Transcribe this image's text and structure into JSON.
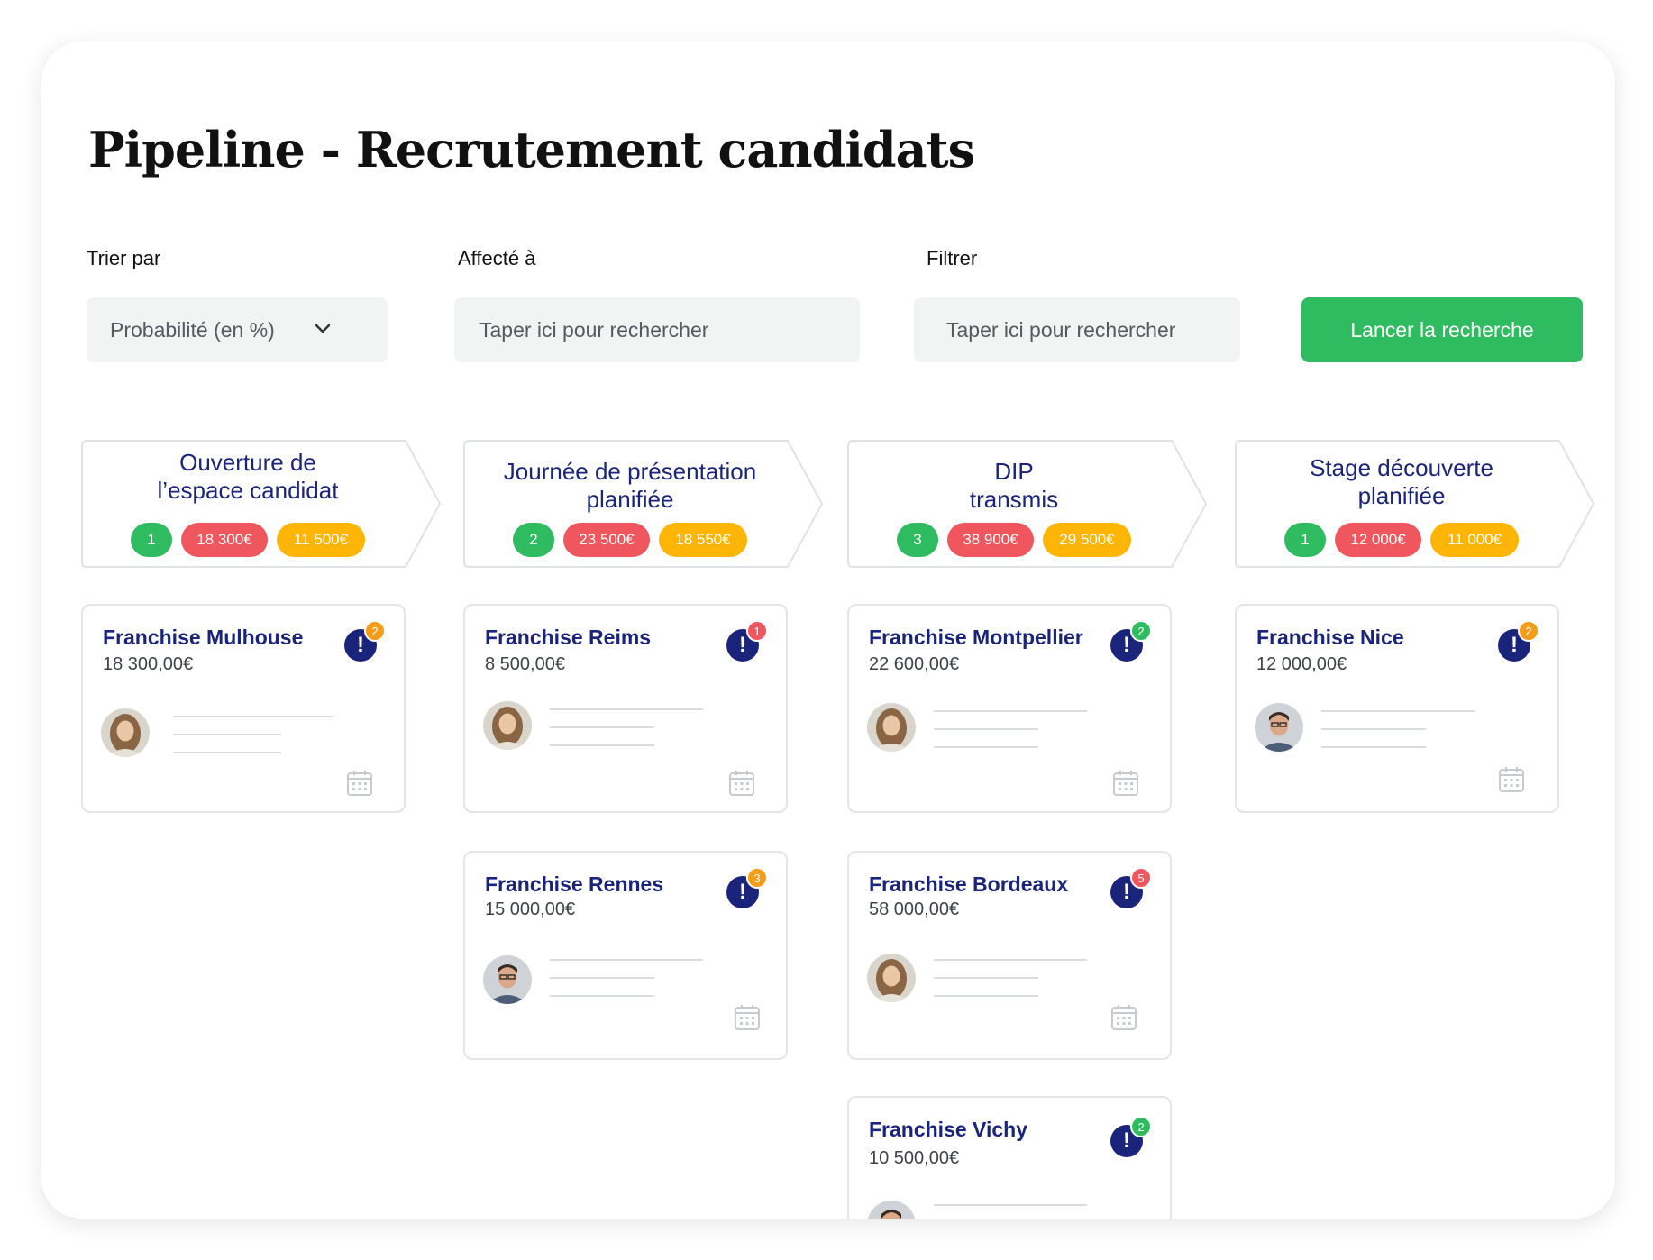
{
  "page": {
    "title": "Pipeline - Recrutement candidats"
  },
  "filters": {
    "sort_label": "Trier par",
    "sort_value": "Probabilité (en %)",
    "assigned_label": "Affecté à",
    "assigned_placeholder": "Taper ici pour rechercher",
    "filter_label": "Filtrer",
    "filter_placeholder": "Taper ici pour rechercher",
    "search_button": "Lancer la recherche"
  },
  "colors": {
    "brand_green": "#2fbb5f",
    "navy": "#1a247a",
    "red": "#f0565e",
    "yellow": "#ffb505",
    "orange": "#f59c1a"
  },
  "stages": [
    {
      "title": "Ouverture de\nl’espace candidat",
      "count": "1",
      "amount_red": "18 300€",
      "amount_yellow": "11 500€"
    },
    {
      "title": "Journée de présentation\nplanifiée",
      "count": "2",
      "amount_red": "23 500€",
      "amount_yellow": "18 550€"
    },
    {
      "title": "DIP\ntransmis",
      "count": "3",
      "amount_red": "38 900€",
      "amount_yellow": "29 500€"
    },
    {
      "title": "Stage découverte\nplanifiée",
      "count": "1",
      "amount_red": "12 000€",
      "amount_yellow": "11 000€"
    }
  ],
  "cards": [
    {
      "name": "Franchise Mulhouse",
      "amount": "18 300,00€",
      "alert_icon": "exclamation-icon",
      "notification_count": "2",
      "notification_color": "orange",
      "avatar": "woman-avatar"
    },
    {
      "name": "Franchise Reims",
      "amount": "8 500,00€",
      "alert_icon": "exclamation-icon",
      "notification_count": "1",
      "notification_color": "red",
      "avatar": "woman-avatar"
    },
    {
      "name": "Franchise Rennes",
      "amount": "15 000,00€",
      "alert_icon": "exclamation-icon",
      "notification_count": "3",
      "notification_color": "orange",
      "avatar": "man-avatar"
    },
    {
      "name": "Franchise Montpellier",
      "amount": "22 600,00€",
      "alert_icon": "exclamation-icon",
      "notification_count": "2",
      "notification_color": "green",
      "avatar": "woman-avatar"
    },
    {
      "name": "Franchise Bordeaux",
      "amount": "58 000,00€",
      "alert_icon": "exclamation-icon",
      "notification_count": "5",
      "notification_color": "red",
      "avatar": "woman-avatar"
    },
    {
      "name": "Franchise Vichy",
      "amount": "10 500,00€",
      "alert_icon": "exclamation-icon",
      "notification_count": "2",
      "notification_color": "green",
      "avatar": "man-avatar"
    },
    {
      "name": "Franchise Nice",
      "amount": "12 000,00€",
      "alert_icon": "exclamation-icon",
      "notification_count": "2",
      "notification_color": "orange",
      "avatar": "man-avatar"
    }
  ]
}
